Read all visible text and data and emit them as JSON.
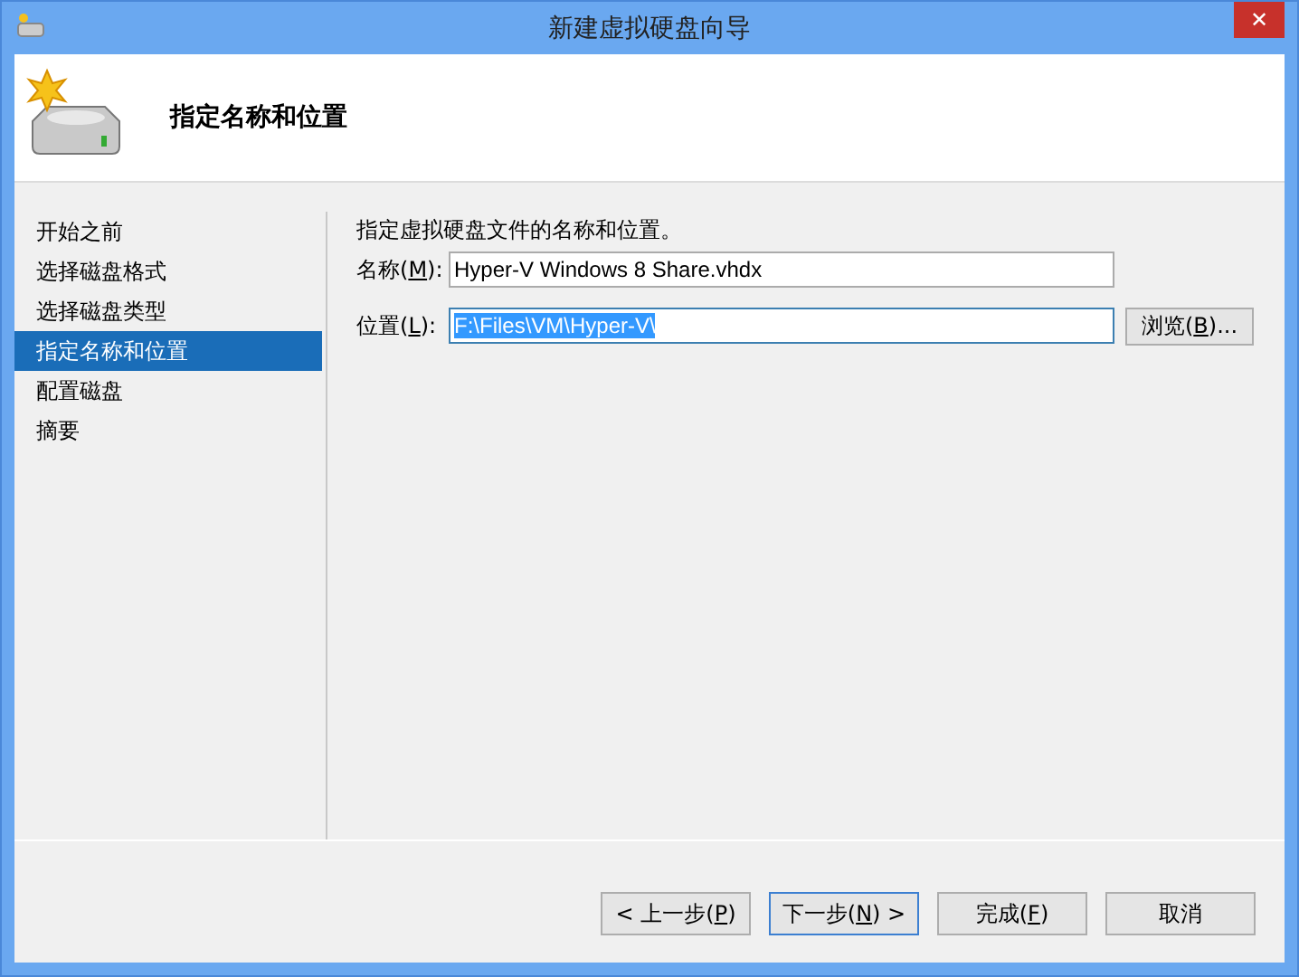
{
  "window": {
    "title": "新建虚拟硬盘向导",
    "close": "✕"
  },
  "header": {
    "title": "指定名称和位置"
  },
  "steps": [
    {
      "label": "开始之前",
      "selected": false
    },
    {
      "label": "选择磁盘格式",
      "selected": false
    },
    {
      "label": "选择磁盘类型",
      "selected": false
    },
    {
      "label": "指定名称和位置",
      "selected": true
    },
    {
      "label": "配置磁盘",
      "selected": false
    },
    {
      "label": "摘要",
      "selected": false
    }
  ],
  "instruction": "指定虚拟硬盘文件的名称和位置。",
  "fields": [
    {
      "label_before": "名称(",
      "access_key": "M",
      "label_after": "):",
      "value": "Hyper-V Windows 8 Share.vhdx",
      "text_selected": false
    },
    {
      "label_before": "位置(",
      "access_key": "L",
      "label_after": "):",
      "value": "F:\\Files\\VM\\Hyper-V\\",
      "text_selected": true,
      "button": {
        "label_before": "浏览(",
        "access_key": "B",
        "label_after": ")..."
      }
    }
  ],
  "buttons": [
    {
      "label_before": "< 上一步(",
      "access_key": "P",
      "label_after": ")",
      "default": false
    },
    {
      "label_before": "下一步(",
      "access_key": "N",
      "label_after": ") >",
      "default": true
    },
    {
      "label_before": "完成(",
      "access_key": "F",
      "label_after": ")",
      "default": false
    },
    {
      "label_before": "取消",
      "default": false
    }
  ]
}
